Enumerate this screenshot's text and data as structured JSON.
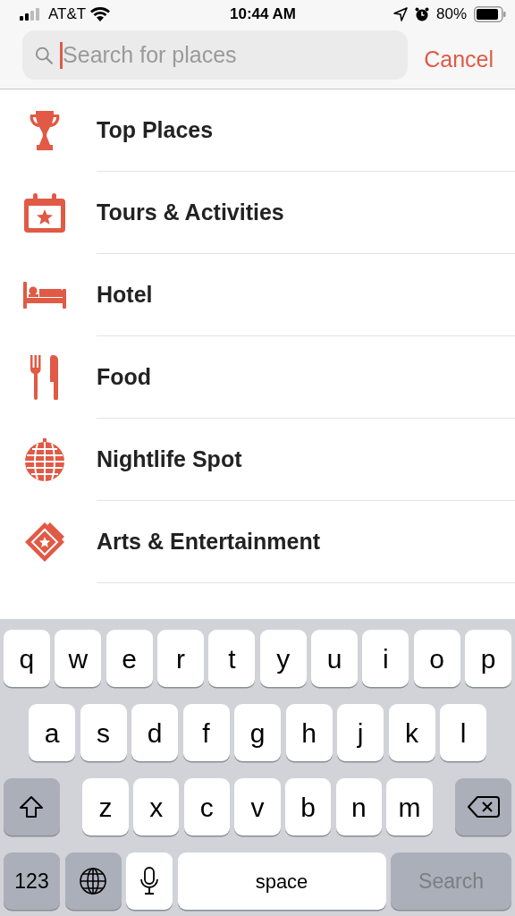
{
  "status_bar": {
    "carrier": "AT&T",
    "time": "10:44 AM",
    "battery": "80%"
  },
  "search": {
    "placeholder": "Search for places",
    "cancel": "Cancel"
  },
  "categories": [
    {
      "label": "Top Places"
    },
    {
      "label": "Tours & Activities"
    },
    {
      "label": "Hotel"
    },
    {
      "label": "Food"
    },
    {
      "label": "Nightlife Spot"
    },
    {
      "label": "Arts & Entertainment"
    }
  ],
  "keyboard": {
    "rows": [
      {
        "keys": [
          {
            "kind": "letter",
            "label": "q"
          },
          {
            "kind": "letter",
            "label": "w"
          },
          {
            "kind": "letter",
            "label": "e"
          },
          {
            "kind": "letter",
            "label": "r"
          },
          {
            "kind": "letter",
            "label": "t"
          },
          {
            "kind": "letter",
            "label": "y"
          },
          {
            "kind": "letter",
            "label": "u"
          },
          {
            "kind": "letter",
            "label": "i"
          },
          {
            "kind": "letter",
            "label": "o"
          },
          {
            "kind": "letter",
            "label": "p"
          }
        ]
      },
      {
        "keys": [
          {
            "kind": "letter",
            "label": "a"
          },
          {
            "kind": "letter",
            "label": "s"
          },
          {
            "kind": "letter",
            "label": "d"
          },
          {
            "kind": "letter",
            "label": "f"
          },
          {
            "kind": "letter",
            "label": "g"
          },
          {
            "kind": "letter",
            "label": "h"
          },
          {
            "kind": "letter",
            "label": "j"
          },
          {
            "kind": "letter",
            "label": "k"
          },
          {
            "kind": "letter",
            "label": "l"
          }
        ]
      },
      {
        "keys": [
          {
            "kind": "shift"
          },
          {
            "kind": "letter",
            "label": "z"
          },
          {
            "kind": "letter",
            "label": "x"
          },
          {
            "kind": "letter",
            "label": "c"
          },
          {
            "kind": "letter",
            "label": "v"
          },
          {
            "kind": "letter",
            "label": "b"
          },
          {
            "kind": "letter",
            "label": "n"
          },
          {
            "kind": "letter",
            "label": "m"
          },
          {
            "kind": "backspace"
          }
        ]
      },
      {
        "keys": [
          {
            "kind": "numbers",
            "label": "123"
          },
          {
            "kind": "globe"
          },
          {
            "kind": "mic"
          },
          {
            "kind": "space",
            "label": "space"
          },
          {
            "kind": "action",
            "label": "Search",
            "disabled": true
          }
        ]
      }
    ]
  }
}
